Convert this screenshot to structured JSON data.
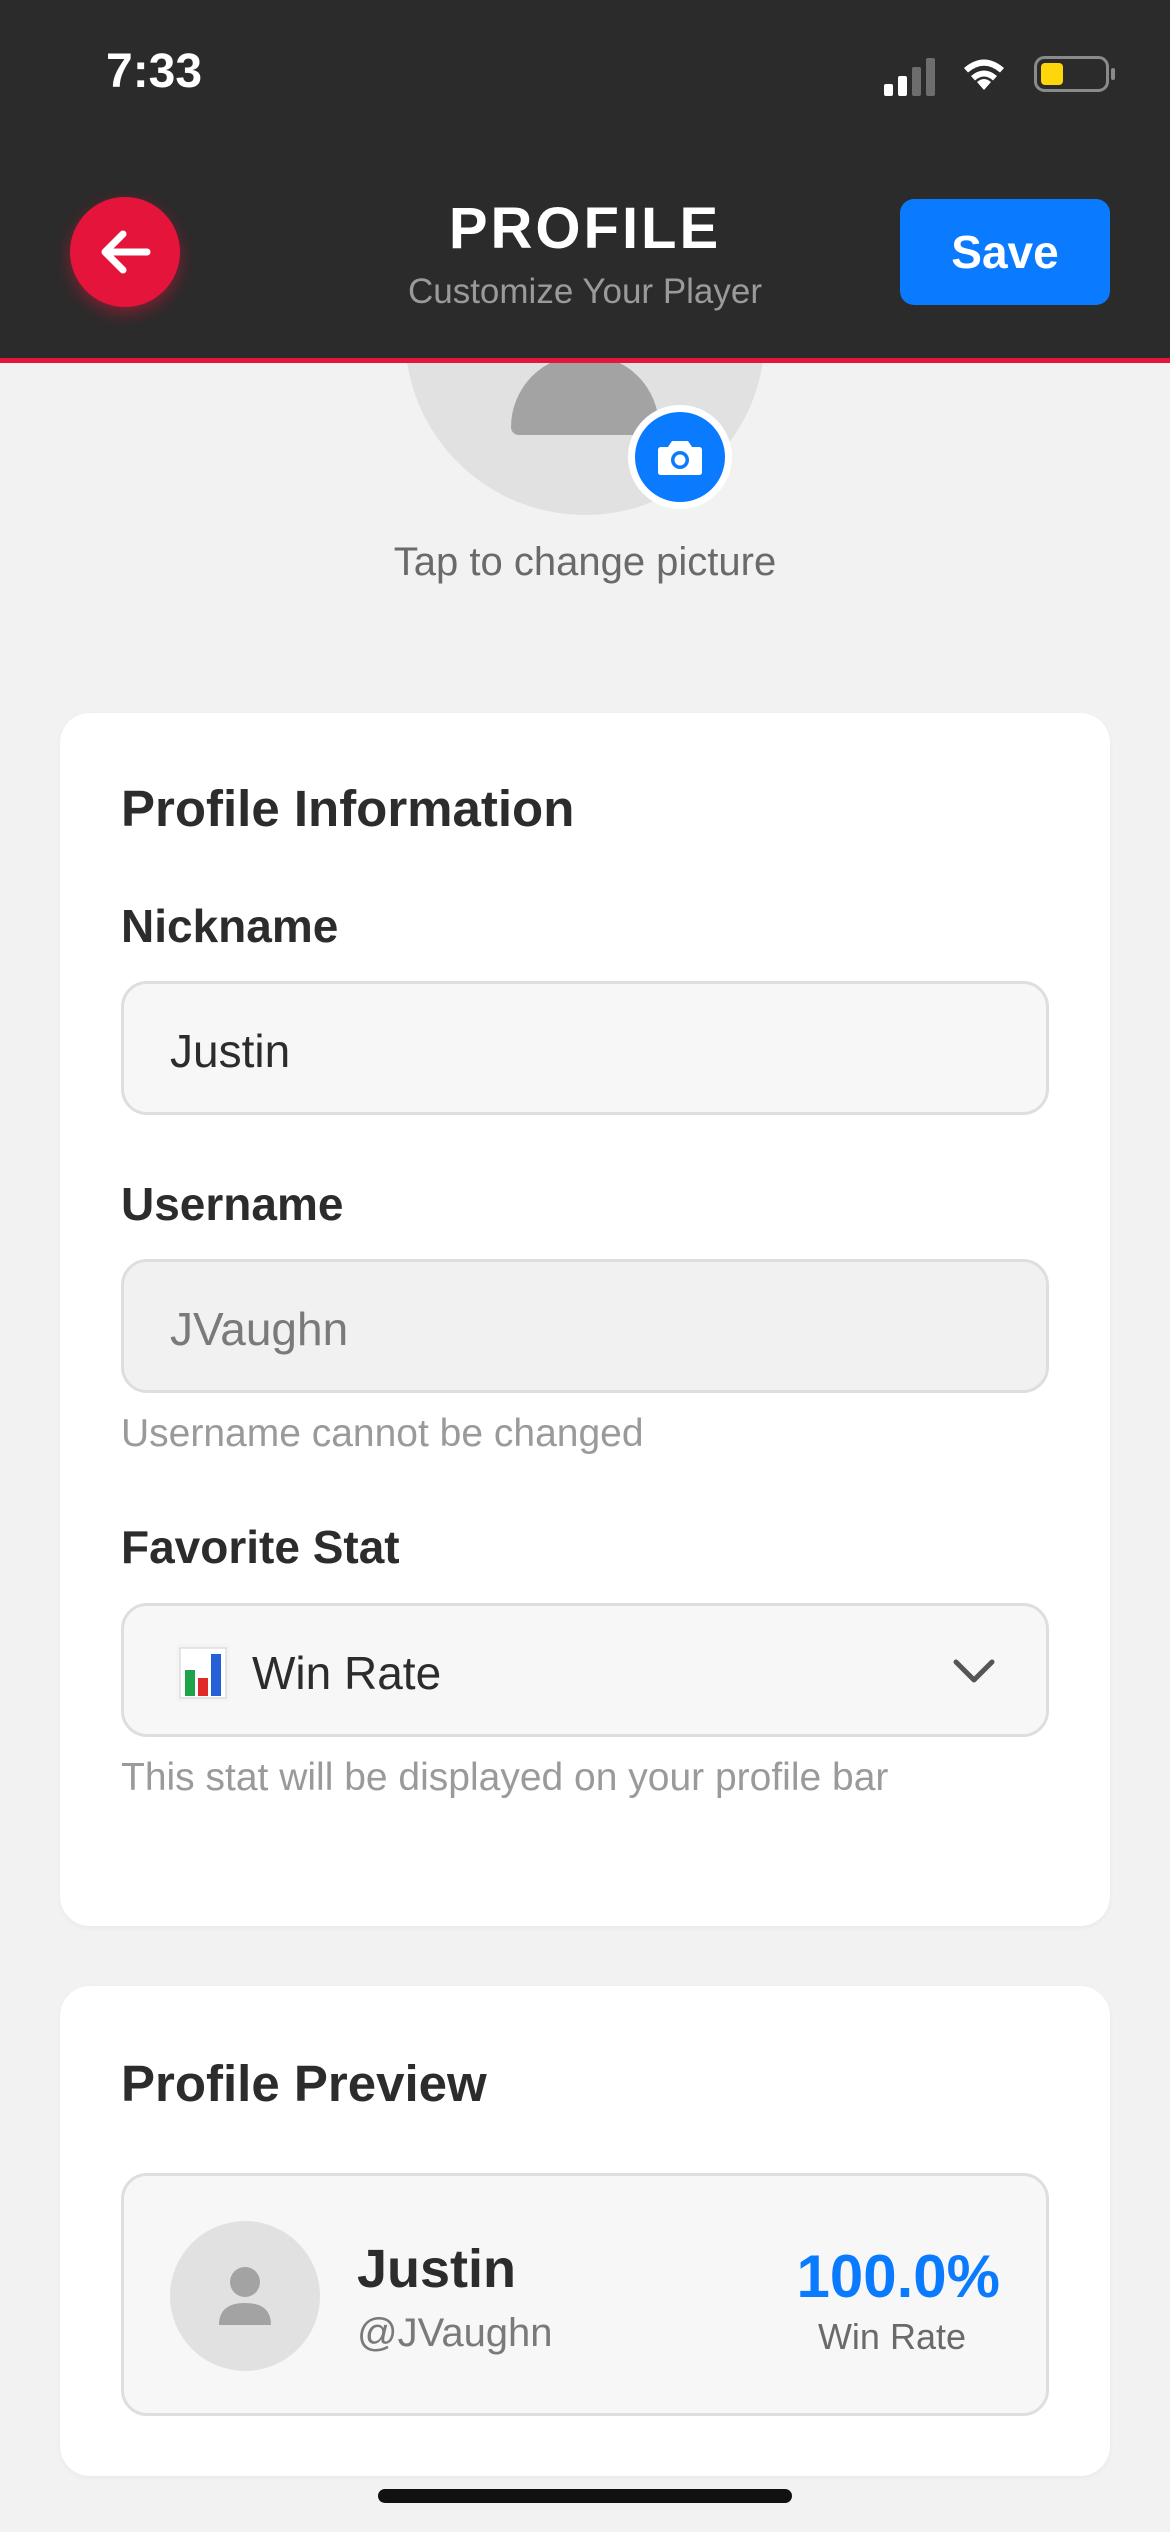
{
  "status_bar": {
    "time": "7:33"
  },
  "header": {
    "title": "PROFILE",
    "subtitle": "Customize Your Player",
    "save_label": "Save",
    "back_icon": "arrow-left-icon"
  },
  "avatar": {
    "change_text": "Tap to change picture",
    "camera_icon": "camera-icon"
  },
  "profile_info": {
    "title": "Profile Information",
    "nickname": {
      "label": "Nickname",
      "value": "Justin"
    },
    "username": {
      "label": "Username",
      "value": "JVaughn",
      "helper": "Username cannot be changed"
    },
    "favorite_stat": {
      "label": "Favorite Stat",
      "selected": "Win Rate",
      "icon": "bar-chart-icon",
      "helper": "This stat will be displayed on your profile bar"
    }
  },
  "preview": {
    "title": "Profile Preview",
    "name": "Justin",
    "handle": "@JVaughn",
    "stat_value": "100.0%",
    "stat_label": "Win Rate"
  },
  "colors": {
    "accent_red": "#e5143b",
    "accent_blue": "#0a7aff",
    "header_bg": "#2b2b2b"
  }
}
